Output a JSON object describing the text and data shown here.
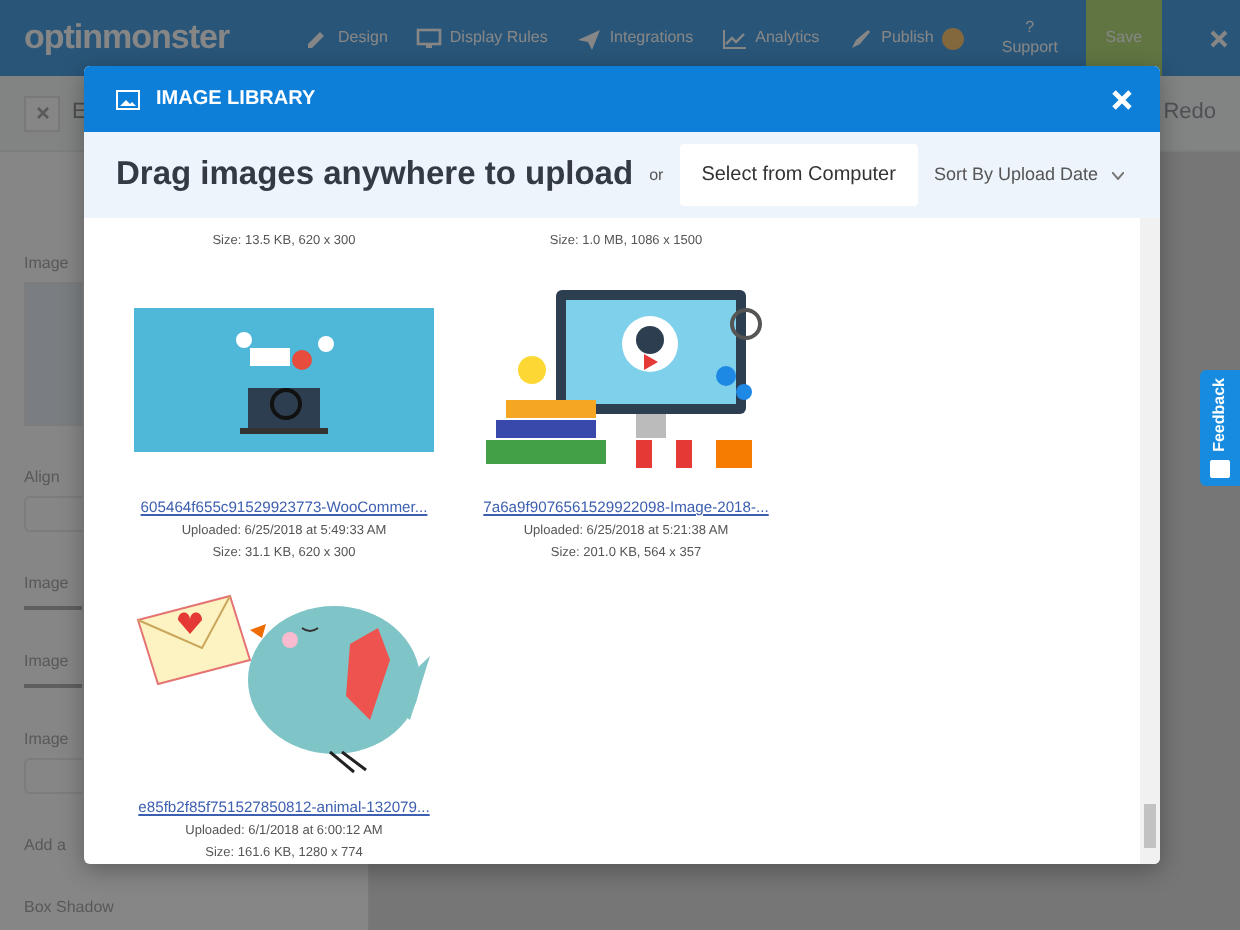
{
  "app": {
    "logo": "optinmonster",
    "nav": [
      {
        "label": "Design"
      },
      {
        "label": "Display Rules"
      },
      {
        "label": "Integrations"
      },
      {
        "label": "Analytics"
      },
      {
        "label": "Publish"
      }
    ],
    "support_mark": "?",
    "support": "Support",
    "save": "Save"
  },
  "toolbar": {
    "title": "E",
    "redo": "Redo"
  },
  "sidebar": {
    "labels": [
      "Image",
      "Align",
      "Image",
      "Image",
      "Image",
      "Add a",
      "Box Shadow"
    ]
  },
  "feedback": "Feedback",
  "modal": {
    "title": "IMAGE LIBRARY",
    "drag_text": "Drag images anywhere to upload",
    "or": "or",
    "select_button": "Select from Computer",
    "sort": "Sort By Upload Date",
    "images": [
      {
        "kind": "cut",
        "size": "Size: 13.5 KB, 620 x 300"
      },
      {
        "kind": "cut",
        "size": "Size: 1.0 MB, 1086 x 1500"
      },
      {
        "kind": "seo",
        "filename": "605464f655c91529923773-WooCommer...",
        "uploaded": "Uploaded: 6/25/2018 at 5:49:33 AM",
        "size": "Size: 31.1 KB, 620 x 300"
      },
      {
        "kind": "video",
        "filename": "7a6a9f9076561529922098-Image-2018-...",
        "uploaded": "Uploaded: 6/25/2018 at 5:21:38 AM",
        "size": "Size: 201.0 KB, 564 x 357"
      },
      {
        "kind": "bird",
        "filename": "e85fb2f85f751527850812-animal-132079...",
        "uploaded": "Uploaded: 6/1/2018 at 6:00:12 AM",
        "size": "Size: 161.6 KB, 1280 x 774"
      }
    ]
  }
}
